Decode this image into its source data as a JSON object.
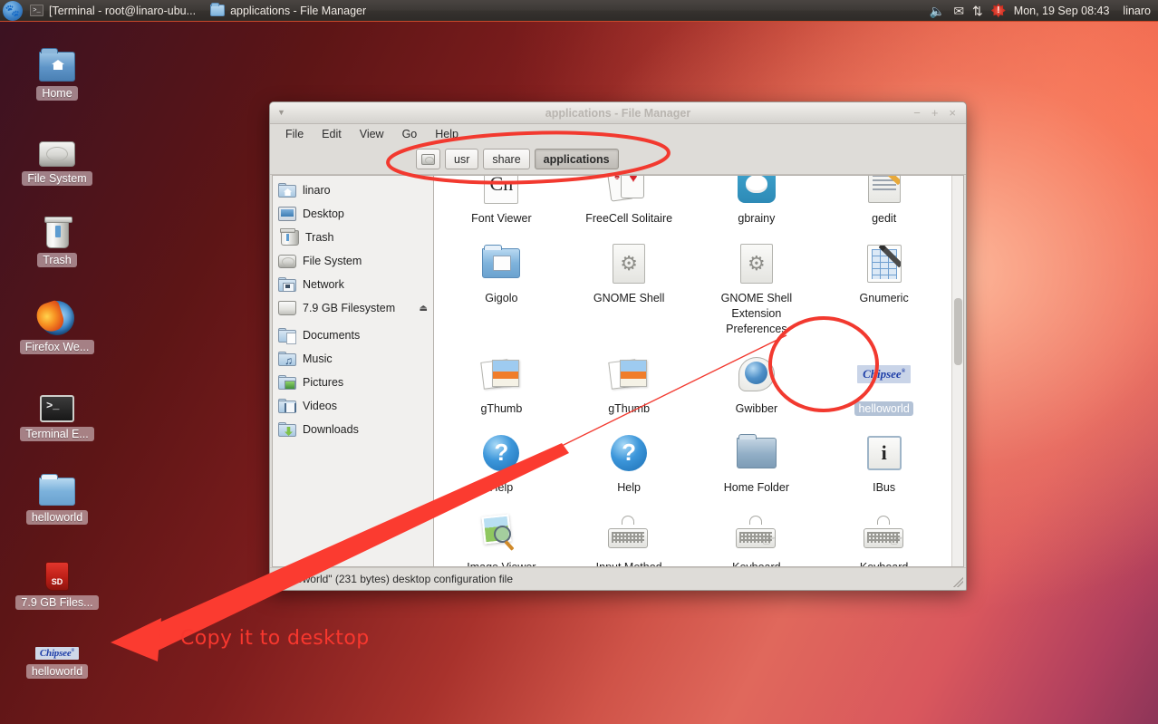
{
  "panel": {
    "logo_icon": "xfce-mouse-logo",
    "tasks": [
      {
        "icon": "terminal-icon",
        "label": "[Terminal - root@linaro-ubu..."
      },
      {
        "icon": "folder-icon",
        "label": "applications - File Manager"
      }
    ],
    "tray": {
      "volume_icon": "speaker-icon",
      "mail_icon": "mail-icon",
      "network_icon": "network-updown-icon",
      "update_icon": "update-alert-icon",
      "clock": "Mon, 19 Sep  08:43",
      "user": "linaro"
    }
  },
  "desktop": {
    "icons": [
      {
        "label": "Home",
        "icon": "home-folder-icon"
      },
      {
        "label": "File System",
        "icon": "harddisk-icon"
      },
      {
        "label": "Trash",
        "icon": "trash-icon"
      },
      {
        "label": "Firefox We...",
        "icon": "firefox-icon"
      },
      {
        "label": "Terminal E...",
        "icon": "terminal-icon"
      },
      {
        "label": "helloworld",
        "icon": "folder-icon"
      },
      {
        "label": "7.9 GB Files...",
        "icon": "sd-card-icon"
      },
      {
        "label": "helloworld",
        "icon": "chipsee-logo-icon",
        "logo_text": "Chipsee"
      }
    ]
  },
  "annotation": {
    "text": "Copy it to desktop",
    "color": "#f8372e"
  },
  "file_manager": {
    "title": "applications - File Manager",
    "window_buttons": {
      "minimize": "−",
      "maximize": "+",
      "close": "×"
    },
    "menus": [
      "File",
      "Edit",
      "View",
      "Go",
      "Help"
    ],
    "path_buttons": [
      {
        "label": "",
        "icon": "harddisk-icon",
        "active": false
      },
      {
        "label": "usr",
        "active": false
      },
      {
        "label": "share",
        "active": false
      },
      {
        "label": "applications",
        "active": true
      }
    ],
    "sidebar": [
      {
        "label": "linaro",
        "icon": "home-folder-icon"
      },
      {
        "label": "Desktop",
        "icon": "desktop-icon"
      },
      {
        "label": "Trash",
        "icon": "trash-icon"
      },
      {
        "label": "File System",
        "icon": "harddisk-icon"
      },
      {
        "label": "Network",
        "icon": "network-folder-icon"
      },
      {
        "label": "7.9 GB Filesystem",
        "icon": "drive-icon",
        "eject": "⏏"
      },
      {
        "label": "Documents",
        "icon": "documents-folder-icon"
      },
      {
        "label": "Music",
        "icon": "music-folder-icon"
      },
      {
        "label": "Pictures",
        "icon": "pictures-folder-icon"
      },
      {
        "label": "Videos",
        "icon": "videos-folder-icon"
      },
      {
        "label": "Downloads",
        "icon": "downloads-folder-icon"
      }
    ],
    "files": [
      {
        "label": "Font Viewer",
        "icon": "font-viewer-icon",
        "glyph": "Cn",
        "selected": false
      },
      {
        "label": "FreeCell Solitaire",
        "icon": "playing-cards-icon",
        "selected": false
      },
      {
        "label": "gbrainy",
        "icon": "gbrainy-icon",
        "selected": false
      },
      {
        "label": "gedit",
        "icon": "gedit-icon",
        "selected": false
      },
      {
        "label": "Gigolo",
        "icon": "gigolo-icon",
        "selected": false
      },
      {
        "label": "GNOME Shell",
        "icon": "gear-icon",
        "selected": false
      },
      {
        "label": "GNOME Shell Extension Preferences",
        "icon": "gear-icon",
        "selected": false
      },
      {
        "label": "Gnumeric",
        "icon": "gnumeric-icon",
        "selected": false
      },
      {
        "label": "gThumb",
        "icon": "gthumb-icon",
        "selected": false
      },
      {
        "label": "gThumb",
        "icon": "gthumb-icon",
        "selected": false
      },
      {
        "label": "Gwibber",
        "icon": "gwibber-icon",
        "selected": false
      },
      {
        "label": "helloworld",
        "icon": "chipsee-logo-icon",
        "logo_text": "Chipsee",
        "selected": true
      },
      {
        "label": "Help",
        "icon": "help-icon",
        "selected": false
      },
      {
        "label": "Help",
        "icon": "help-icon",
        "selected": false
      },
      {
        "label": "Home Folder",
        "icon": "home-folder-icon",
        "selected": false
      },
      {
        "label": "IBus",
        "icon": "ibus-icon",
        "glyph": "i",
        "selected": false
      },
      {
        "label": "Image Viewer",
        "icon": "image-viewer-icon",
        "selected": false
      },
      {
        "label": "Input Method Switcher",
        "icon": "keyboard-icon",
        "selected": false
      },
      {
        "label": "Keyboard",
        "icon": "keyboard-hand-icon",
        "selected": false
      },
      {
        "label": "Keyboard",
        "icon": "keyboard-hand-icon",
        "selected": false
      }
    ],
    "status": "\"helloworld\" (231 bytes) desktop configuration file"
  }
}
